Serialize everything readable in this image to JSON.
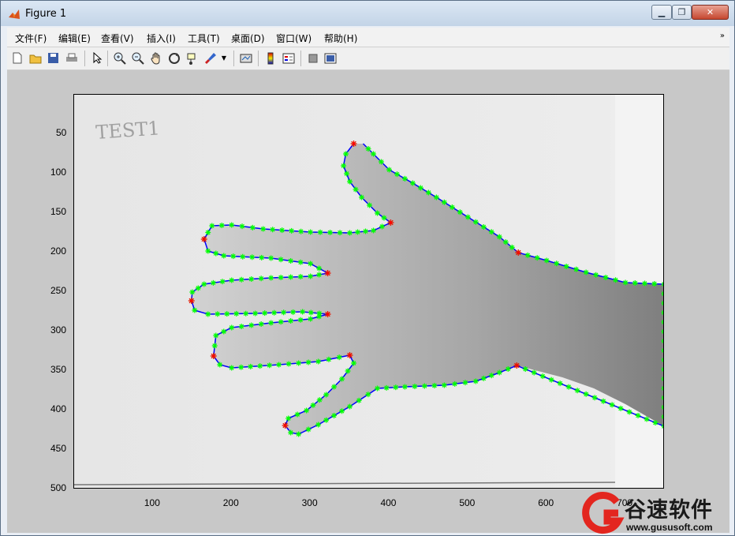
{
  "window": {
    "title": "Figure 1",
    "min_symbol": "▁",
    "max_symbol": "❐",
    "close_symbol": "✕"
  },
  "menu": [
    "文件(F)",
    "编辑(E)",
    "查看(V)",
    "插入(I)",
    "工具(T)",
    "桌面(D)",
    "窗口(W)",
    "帮助(H)"
  ],
  "menu_overflow": "»",
  "toolbar": [
    "new-figure-icon",
    "open-file-icon",
    "save-icon",
    "print-icon",
    "pointer-icon",
    "zoom-in-icon",
    "zoom-out-icon",
    "pan-icon",
    "rotate-3d-icon",
    "data-cursor-icon",
    "brush-icon",
    "dropdown-arrow-icon",
    "link-plot-icon",
    "colorbar-icon",
    "legend-icon",
    "hide-plot-tools-icon",
    "show-plot-tools-icon"
  ],
  "axes": {
    "x_ticks": [
      "100",
      "200",
      "300",
      "400",
      "500",
      "600",
      "700"
    ],
    "y_ticks": [
      "50",
      "100",
      "150",
      "200",
      "250",
      "300",
      "350",
      "400",
      "450",
      "500"
    ],
    "xlim": [
      0,
      750
    ],
    "ylim": [
      500,
      0
    ]
  },
  "image_annotation": {
    "handwritten": "TEST1"
  },
  "contour_colors": {
    "line": "#0000ff",
    "points": "#00ff00",
    "keypoints": "#ff0000"
  },
  "keypoints": [
    {
      "x": 355,
      "y": 62
    },
    {
      "x": 402,
      "y": 162
    },
    {
      "x": 564,
      "y": 200
    },
    {
      "x": 165,
      "y": 183
    },
    {
      "x": 322,
      "y": 226
    },
    {
      "x": 149,
      "y": 261
    },
    {
      "x": 322,
      "y": 278
    },
    {
      "x": 177,
      "y": 331
    },
    {
      "x": 350,
      "y": 330
    },
    {
      "x": 268,
      "y": 419
    },
    {
      "x": 562,
      "y": 343
    }
  ],
  "watermark": {
    "brand": "谷速软件",
    "url": "www.gususoft.com"
  }
}
